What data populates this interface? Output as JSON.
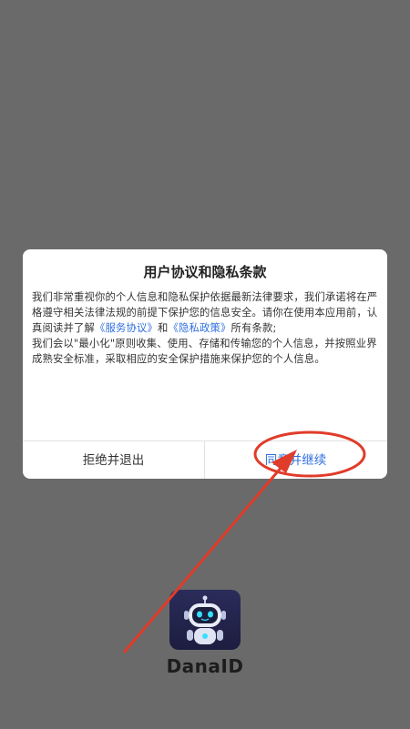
{
  "app": {
    "name": "DanaID",
    "logo_icon": "robot-icon"
  },
  "dialog": {
    "title": "用户协议和隐私条款",
    "body": {
      "p1_a": "我们非常重视你的个人信息和隐私保护依据最新法律要求，我们承诺将在严格遵守相关法律法规的前提下保护您的信息安全。请你在使用本应用前，认真阅读并了解",
      "link_service": "《服务协议》",
      "and": "和",
      "link_privacy": "《隐私政策》",
      "p1_b": "所有条款;",
      "p2": " 我们会以\"最小化\"原则收集、使用、存储和传输您的个人信息，并按照业界成熟安全标准，采取相应的安全保护措施来保护您的个人信息。"
    },
    "buttons": {
      "reject": "拒绝并退出",
      "agree": "同意并继续"
    }
  },
  "colors": {
    "overlay": "#6a6a6a",
    "link": "#2f6fde",
    "annotation": "#e03c2a"
  }
}
